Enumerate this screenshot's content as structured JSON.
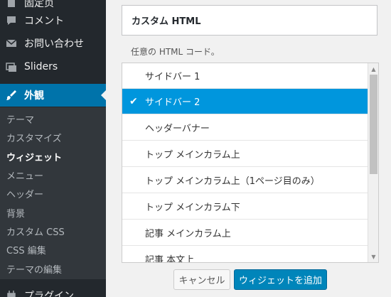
{
  "sidebar": {
    "menu": [
      {
        "label": "固定页",
        "icon": "page-icon"
      },
      {
        "label": "コメント",
        "icon": "comment-icon"
      },
      {
        "label": "お問い合わせ",
        "icon": "mail-icon"
      },
      {
        "label": "Sliders",
        "icon": "slider-icon"
      },
      {
        "label": "外観",
        "icon": "paintbrush-icon"
      },
      {
        "label": "プラグイン",
        "icon": "plugin-icon"
      }
    ],
    "submenu": [
      "テーマ",
      "カスタマイズ",
      "ウィジェット",
      "メニュー",
      "ヘッダー",
      "背景",
      "カスタム CSS",
      "CSS 編集",
      "テーマの編集"
    ]
  },
  "widget": {
    "title": "カスタム HTML",
    "description": "任意の HTML コード。",
    "areas": [
      "サイドバー 1",
      "サイドバー 2",
      "ヘッダーバナー",
      "トップ メインカラム上",
      "トップ メインカラム上（1ページ目のみ）",
      "トップ メインカラム下",
      "記事 メインカラム上",
      "記事 本文上"
    ],
    "selected_check": "✔"
  },
  "buttons": {
    "cancel": "キャンセル",
    "add": "ウィジェットを追加"
  },
  "colors": {
    "sidebar_bg": "#23282d",
    "active_menu": "#0073aa",
    "selected_area": "#0096dd",
    "primary_button": "#0085ba"
  }
}
